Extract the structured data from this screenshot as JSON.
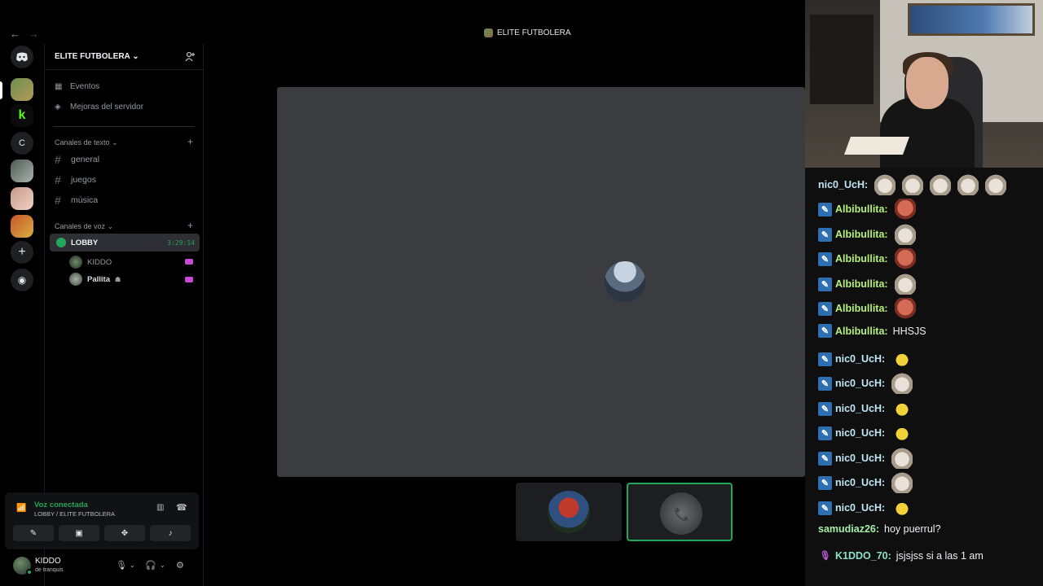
{
  "window": {
    "title": "ELITE FUTBOLERA",
    "nav_back": "←",
    "nav_forward": "→"
  },
  "server": {
    "name": "ELITE FUTBOLERA",
    "links": [
      {
        "label": "Eventos",
        "icon": "calendar-icon"
      },
      {
        "label": "Mejoras del servidor",
        "icon": "boost-icon"
      }
    ],
    "text_category": "Canales de texto",
    "text_channels": [
      "general",
      "juegos",
      "música"
    ],
    "voice_category": "Canales de voz",
    "voice_channel": {
      "name": "LOBBY",
      "timer": "3:29:14"
    },
    "voice_users": [
      "KIDDO",
      "Pallita"
    ]
  },
  "rail": {
    "letter_server": "C"
  },
  "voice_panel": {
    "status": "Voz conectada",
    "location": "LOBBY / ELITE FUTBOLERA"
  },
  "user": {
    "name": "KIDDO",
    "status": "de tranquis"
  },
  "chat": {
    "messages": [
      {
        "user": "nic0_UcH:",
        "text": "",
        "emotes": [
          "cat",
          "cat",
          "cat",
          "cat",
          "cat"
        ],
        "badge": false,
        "cls": "ni"
      },
      {
        "user": "Albibullita:",
        "text": "",
        "emotes": [
          "face"
        ],
        "badge": true,
        "cls": "al"
      },
      {
        "user": "Albibullita:",
        "text": "",
        "emotes": [
          "cat"
        ],
        "badge": true,
        "cls": "al"
      },
      {
        "user": "Albibullita:",
        "text": "",
        "emotes": [
          "face"
        ],
        "badge": true,
        "cls": "al"
      },
      {
        "user": "Albibullita:",
        "text": "",
        "emotes": [
          "cat"
        ],
        "badge": true,
        "cls": "al"
      },
      {
        "user": "Albibullita:",
        "text": "",
        "emotes": [
          "face"
        ],
        "badge": true,
        "cls": "al"
      },
      {
        "user": "Albibullita:",
        "text": "HHSJS",
        "emotes": [],
        "badge": true,
        "cls": "al"
      },
      {
        "user": "nic0_UcH:",
        "text": "",
        "emotes": [
          "ball"
        ],
        "badge": true,
        "cls": "ni"
      },
      {
        "user": "nic0_UcH:",
        "text": "",
        "emotes": [
          "cat"
        ],
        "badge": true,
        "cls": "ni"
      },
      {
        "user": "nic0_UcH:",
        "text": "",
        "emotes": [
          "ball"
        ],
        "badge": true,
        "cls": "ni"
      },
      {
        "user": "nic0_UcH:",
        "text": "",
        "emotes": [
          "ball"
        ],
        "badge": true,
        "cls": "ni"
      },
      {
        "user": "nic0_UcH:",
        "text": "",
        "emotes": [
          "cat"
        ],
        "badge": true,
        "cls": "ni"
      },
      {
        "user": "nic0_UcH:",
        "text": "",
        "emotes": [
          "cat"
        ],
        "badge": true,
        "cls": "ni"
      },
      {
        "user": "nic0_UcH:",
        "text": "",
        "emotes": [
          "ball"
        ],
        "badge": true,
        "cls": "ni"
      },
      {
        "user": "samudiaz26:",
        "text": "hoy puerrul?",
        "emotes": [],
        "badge": false,
        "cls": "sa"
      },
      {
        "user": "K1DDO_70:",
        "text": "jsjsjss si a las 1 am",
        "emotes": [],
        "badge": "mic",
        "cls": "k1"
      }
    ]
  },
  "colors": {
    "accent_green": "#23a55a",
    "stage_bg": "#3b3c40",
    "chat_bg": "#0f0f10"
  }
}
